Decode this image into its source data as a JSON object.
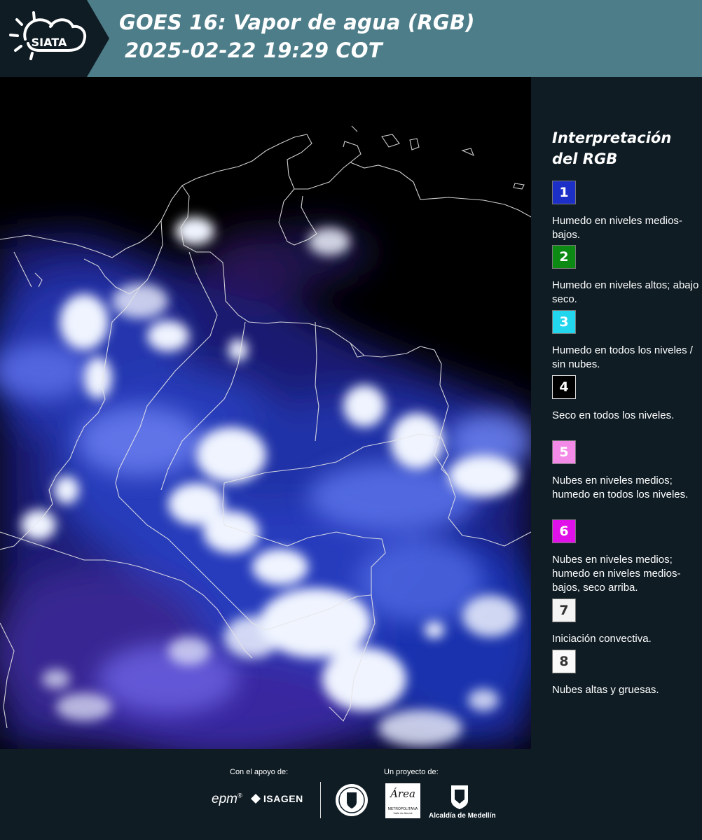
{
  "header": {
    "logo_text": "SIATA",
    "title_line1": "GOES 16: Vapor de agua (RGB)",
    "title_line2": "2025-02-22 19:29 COT"
  },
  "map": {
    "icon": "satellite-rgb-water-vapor-image"
  },
  "legend": {
    "title_line1": "Interpretación",
    "title_line2": "del RGB",
    "items": [
      {
        "num": "1",
        "color": "#1c30c8",
        "text_color": "#ffffff",
        "text": "Humedo en niveles medios-bajos."
      },
      {
        "num": "2",
        "color": "#0c8a14",
        "text_color": "#ffffff",
        "text": "Humedo en niveles altos; abajo seco."
      },
      {
        "num": "3",
        "color": "#22d6ee",
        "text_color": "#ffffff",
        "text": "Humedo en todos los niveles / sin nubes."
      },
      {
        "num": "4",
        "color": "#000000",
        "text_color": "#ffffff",
        "text": "Seco en todos los niveles."
      },
      {
        "num": "5",
        "color": "#f48ae8",
        "text_color": "#ffffff",
        "text": "Nubes en niveles medios; humedo en todos los niveles."
      },
      {
        "num": "6",
        "color": "#e010e8",
        "text_color": "#ffffff",
        "text": "Nubes en niveles medios; humedo en niveles medios-bajos, seco arriba."
      },
      {
        "num": "7",
        "color": "#f4f4f4",
        "text_color": "#333333",
        "text": "Iniciación convectiva."
      },
      {
        "num": "8",
        "color": "#fafafa",
        "text_color": "#333333",
        "text": "Nubes altas y gruesas."
      }
    ]
  },
  "footer": {
    "support_label": "Con el apoyo de:",
    "project_label": "Un proyecto de:",
    "epm": "epm",
    "isagen": "ISAGEN",
    "area_metropolitana": "Área",
    "area_sub": "METROPOLITANA",
    "area_sub2": "Valle de Aburrá",
    "alcaldia": "Alcaldía de Medellín"
  }
}
